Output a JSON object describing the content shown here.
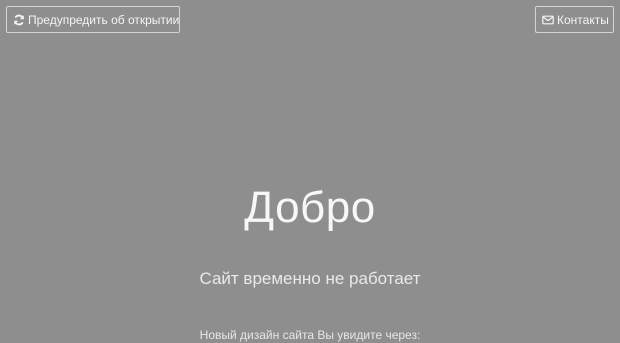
{
  "header": {
    "notify_button": {
      "label": "Предупредить об открытии",
      "icon": "refresh-icon"
    },
    "contacts_button": {
      "label": "Контакты",
      "icon": "envelope-icon"
    }
  },
  "main": {
    "headline": "Добро",
    "subtitle": "Сайт временно не работает",
    "countdown_label": "Новый дизайн сайта Вы увидите через:"
  },
  "colors": {
    "background": "#8e8e8e",
    "text": "#f2f2f2",
    "button_border": "#d4d4d4"
  }
}
